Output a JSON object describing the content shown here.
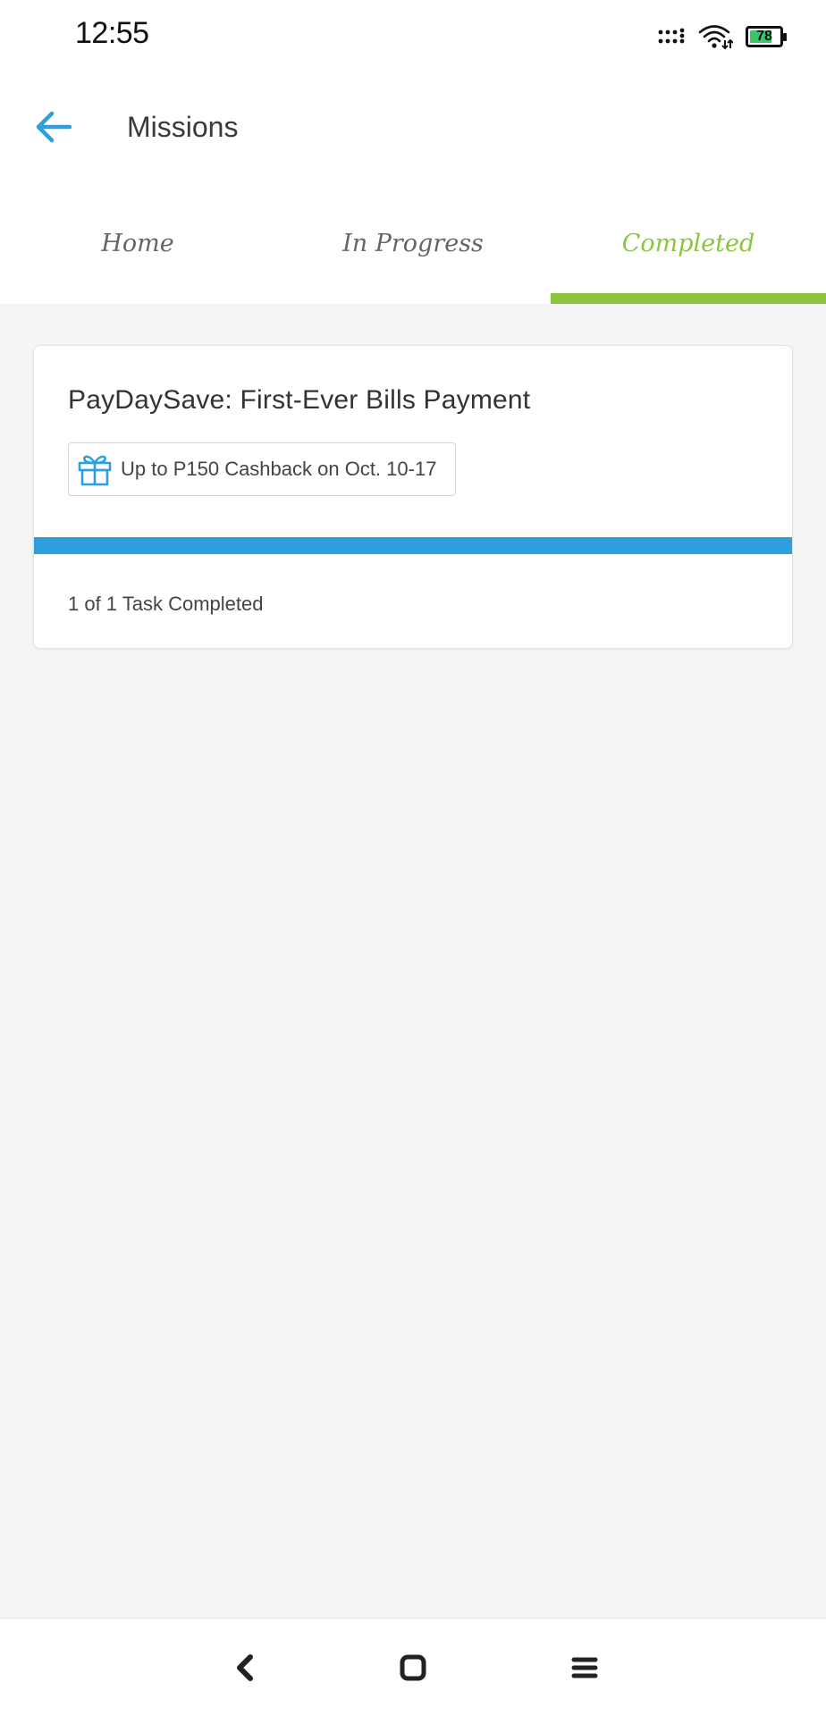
{
  "status_bar": {
    "time": "12:55",
    "battery_level": "78",
    "battery_fraction": 0.78,
    "icons": [
      "signal-dots-icon",
      "wifi-icon",
      "battery-icon"
    ]
  },
  "header": {
    "title": "Missions",
    "back_icon": "arrow-left-icon"
  },
  "tabs": [
    {
      "label": "Home",
      "active": false
    },
    {
      "label": "In Progress",
      "active": false
    },
    {
      "label": "Completed",
      "active": true
    }
  ],
  "missions": [
    {
      "title": "PayDaySave: First-Ever Bills Payment",
      "reward": "Up to P150 Cashback on Oct. 10-17",
      "reward_icon": "gift-icon",
      "progress": 1.0,
      "status": "1 of 1 Task Completed"
    }
  ],
  "nav_bar": {
    "buttons": [
      "back-nav-icon",
      "home-nav-icon",
      "menu-nav-icon"
    ]
  },
  "colors": {
    "accent_blue": "#2d9fdc",
    "accent_green": "#8cc63f",
    "background": "#f5f5f5"
  }
}
